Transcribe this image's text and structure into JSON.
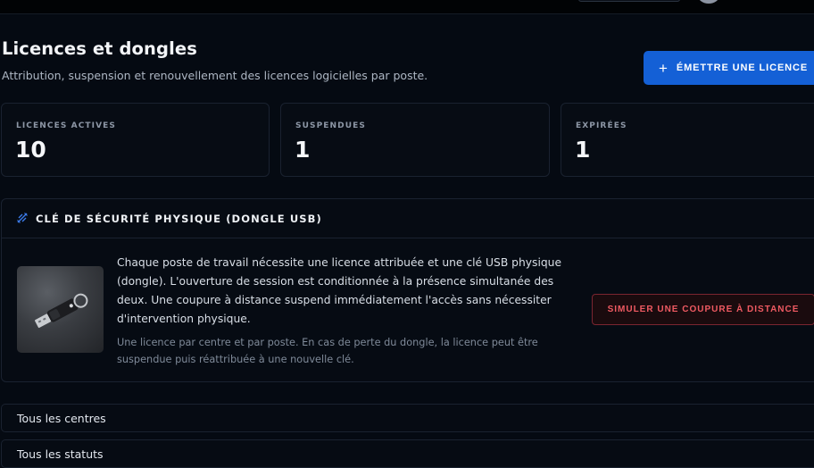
{
  "header": {
    "title": "Licences et dongles",
    "subtitle": "Attribution, suspension et renouvellement des licences logicielles par poste.",
    "issue_button_icon": "+",
    "issue_button_label": "ÉMETTRE UNE LICENCE"
  },
  "stats": [
    {
      "label": "LICENCES ACTIVES",
      "value": "10"
    },
    {
      "label": "SUSPENDUES",
      "value": "1"
    },
    {
      "label": "EXPIRÉES",
      "value": "1"
    }
  ],
  "dongle_card": {
    "icon": "usb-link-icon",
    "title": "CLÉ DE SÉCURITÉ PHYSIQUE (DONGLE USB)",
    "image": "usb-dongle-photo",
    "description": "Chaque poste de travail nécessite une licence attribuée et une clé USB physique (dongle). L'ouverture de session est conditionnée à la présence simultanée des deux. Une coupure à distance suspend immédiatement l'accès sans nécessiter d'intervention physique.",
    "note": "Une licence par centre et par poste. En cas de perte du dongle, la licence peut être suspendue puis réattribuée à une nouvelle clé.",
    "simulate_button_label": "SIMULER UNE COUPURE À DISTANCE"
  },
  "filters": {
    "centers": "Tous les centres",
    "statuses": "Tous les statuts"
  },
  "colors": {
    "accent": "#1460d6",
    "danger": "#ef5a62",
    "background": "#050a12"
  }
}
